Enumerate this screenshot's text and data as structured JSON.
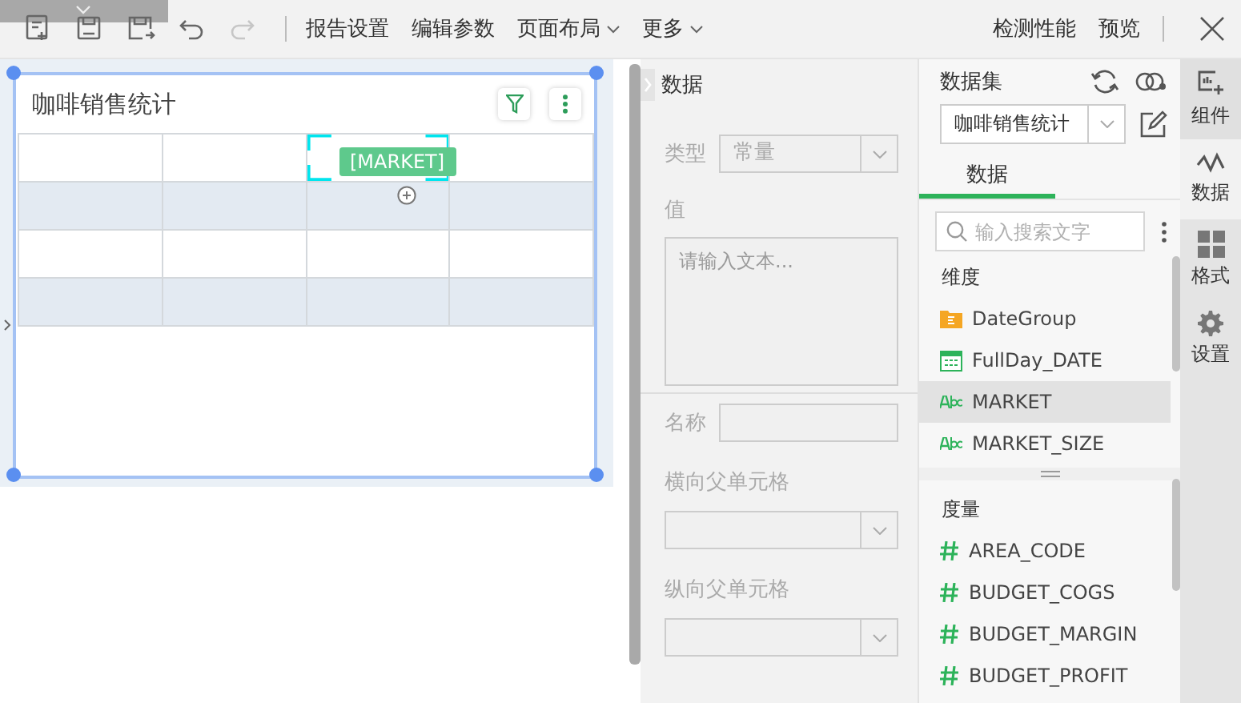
{
  "toolbar": {
    "tools": [
      {
        "kind": "new",
        "disabled": false
      },
      {
        "kind": "save",
        "disabled": false
      },
      {
        "kind": "save-as",
        "disabled": false
      },
      {
        "kind": "undo",
        "disabled": false
      },
      {
        "kind": "redo",
        "disabled": true
      }
    ],
    "menus": [
      {
        "label": "报告设置",
        "dropdown": false
      },
      {
        "label": "编辑参数",
        "dropdown": false
      },
      {
        "label": "页面布局",
        "dropdown": true
      },
      {
        "label": "更多",
        "dropdown": true
      }
    ],
    "right": [
      {
        "label": "检测性能"
      },
      {
        "label": "预览"
      }
    ]
  },
  "widget": {
    "title": "咖啡销售统计",
    "rows": [
      {
        "striped": false,
        "cells": [
          {
            "selected": false
          },
          {
            "selected": false
          },
          {
            "selected": true,
            "tag": "[MARKET]"
          },
          {
            "selected": false
          }
        ]
      },
      {
        "striped": true,
        "cells": [
          {
            "selected": false
          },
          {
            "selected": false
          },
          {
            "selected": false
          },
          {
            "selected": false
          }
        ]
      },
      {
        "striped": false,
        "cells": [
          {
            "selected": false
          },
          {
            "selected": false
          },
          {
            "selected": false
          },
          {
            "selected": false
          }
        ]
      },
      {
        "striped": true,
        "cells": [
          {
            "selected": false
          },
          {
            "selected": false
          },
          {
            "selected": false
          },
          {
            "selected": false
          }
        ]
      }
    ]
  },
  "properties": {
    "title": "数据",
    "fields": [
      {
        "kind": "select",
        "label": "类型",
        "value": "常量",
        "disabled": true
      },
      {
        "kind": "textarea",
        "label": "值",
        "placeholder": "请输入文本...",
        "disabled": true
      },
      {
        "kind": "input",
        "label": "名称",
        "disabled": true
      },
      {
        "kind": "select-below",
        "label": "横向父单元格",
        "disabled": true
      },
      {
        "kind": "select-below",
        "label": "纵向父单元格",
        "disabled": true
      }
    ]
  },
  "dataset": {
    "label": "数据集",
    "value": "咖啡销售统计",
    "tabs": [
      {
        "label": "数据",
        "selected": true
      }
    ],
    "search": {
      "placeholder": "输入搜索文字"
    },
    "dimensions": {
      "title": "维度",
      "items": [
        {
          "kind": "folder",
          "label": "DateGroup",
          "selected": false
        },
        {
          "kind": "date",
          "label": "FullDay_DATE",
          "selected": false
        },
        {
          "kind": "text",
          "label": "MARKET",
          "selected": true
        },
        {
          "kind": "text",
          "label": "MARKET_SIZE",
          "selected": false
        }
      ]
    },
    "measures": {
      "title": "度量",
      "items": [
        {
          "kind": "number",
          "label": "AREA_CODE",
          "selected": false
        },
        {
          "kind": "number",
          "label": "BUDGET_COGS",
          "selected": false
        },
        {
          "kind": "number",
          "label": "BUDGET_MARGIN",
          "selected": false
        },
        {
          "kind": "number",
          "label": "BUDGET_PROFIT",
          "selected": false
        }
      ]
    }
  },
  "side_tabs": [
    {
      "kind": "component",
      "label": "组件",
      "selected": false
    },
    {
      "kind": "data",
      "label": "数据",
      "selected": true
    },
    {
      "kind": "format",
      "label": "格式",
      "selected": false
    },
    {
      "kind": "settings",
      "label": "设置",
      "selected": false
    }
  ]
}
